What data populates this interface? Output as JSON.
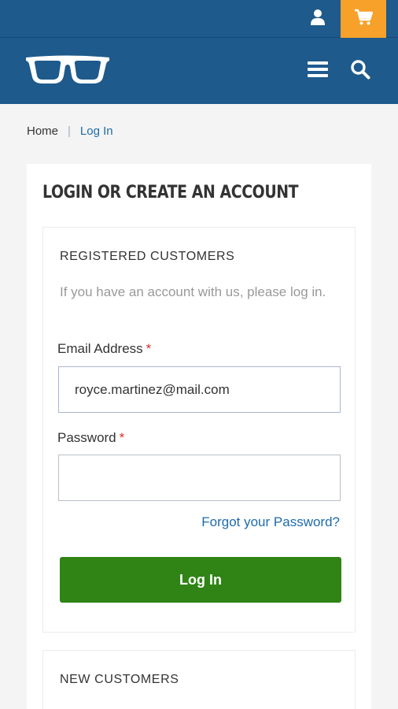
{
  "header": {
    "account_icon": "user-icon",
    "cart_icon": "cart-icon",
    "logo_icon": "glasses-logo",
    "menu_icon": "hamburger-menu-icon",
    "search_icon": "search-icon",
    "colors": {
      "brand": "#1e5a8c",
      "cart": "#f7a12a"
    }
  },
  "breadcrumb": {
    "home": "Home",
    "separator": "|",
    "current": "Log In"
  },
  "page": {
    "title": "LOGIN OR CREATE AN ACCOUNT"
  },
  "registered": {
    "title": "REGISTERED CUSTOMERS",
    "intro": "If you have an account with us, please log in.",
    "email_label": "Email Address",
    "email_value": "royce.martinez@mail.com",
    "password_label": "Password",
    "password_value": "",
    "required_mark": "*",
    "forgot_link": "Forgot your Password?",
    "login_button": "Log In",
    "button_color": "#2f8415"
  },
  "new_customers": {
    "title": "NEW CUSTOMERS"
  }
}
